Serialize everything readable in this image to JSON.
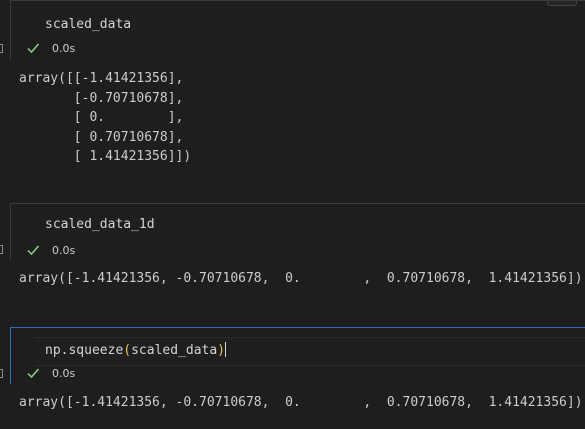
{
  "cells": [
    {
      "code": "scaled_data",
      "duration": "0.0s",
      "output": "array([[-1.41421356],\n       [-0.70710678],\n       [ 0.        ],\n       [ 0.70710678],\n       [ 1.41421356]])"
    },
    {
      "code": "scaled_data_1d",
      "duration": "0.0s",
      "output": "array([-1.41421356, -0.70710678,  0.        ,  0.70710678,  1.41421356])"
    },
    {
      "code_prefix": "np.squeeze",
      "code_open_paren": "(",
      "code_arg": "scaled_data",
      "code_close_paren": ")",
      "duration": "0.0s",
      "output": "array([-1.41421356, -0.70710678,  0.        ,  0.70710678,  1.41421356])"
    }
  ],
  "icons": {
    "success": "check-icon",
    "toolbar": "copy-icon"
  },
  "colors": {
    "success": "#89d185",
    "focus_border": "#2b6fb5",
    "bracket": "#e8c94a"
  }
}
